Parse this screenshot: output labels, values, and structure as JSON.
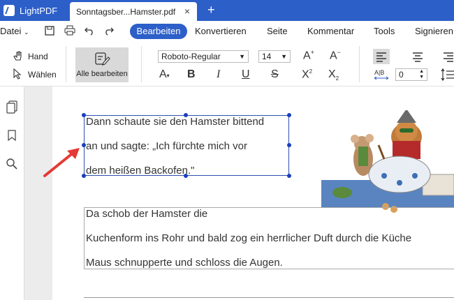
{
  "tabs": {
    "app_label": "LightPDF",
    "doc_label": "Sonntagsber...Hamster.pdf",
    "close": "×",
    "new": "+"
  },
  "menu": {
    "file": "Datei",
    "items": [
      "Bearbeiten",
      "Konvertieren",
      "Seite",
      "Kommentar",
      "Tools",
      "Signieren"
    ]
  },
  "ribbon": {
    "hand": "Hand",
    "select": "Wählen",
    "edit_all": "Alle bearbeiten",
    "font": "Roboto-Regular",
    "size": "14",
    "spacing": "0"
  },
  "doc": {
    "para1": [
      "Dann schaute sie den Hamster bittend",
      "an und sagte: „Ich fürchte mich vor",
      "dem heißen Backofen.\""
    ],
    "para2": [
      "Da schob der Hamster die",
      "Kuchenform ins Rohr und bald zog ein herrlicher Duft durch die Küche",
      "Maus schnupperte und schloss die Augen."
    ]
  },
  "colors": {
    "accent": "#2d5fc9",
    "arrow": "#e53935"
  }
}
